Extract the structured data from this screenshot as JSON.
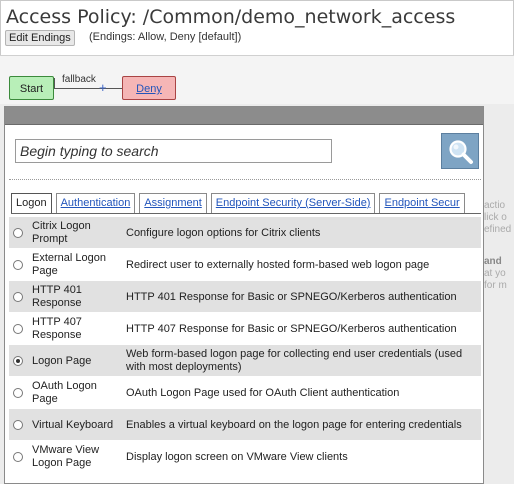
{
  "header": {
    "title": "Access Policy: /Common/demo_network_access",
    "edit_endings_label": "Edit Endings",
    "endings_text": "(Endings: Allow, Deny [default])"
  },
  "flow": {
    "start_label": "Start",
    "branch_label": "fallback",
    "plus_symbol": "+",
    "deny_label": "Deny",
    "start_color": "#b8efb8",
    "deny_color": "#f5b6b6"
  },
  "search": {
    "placeholder": "Begin typing to search",
    "button_icon": "search-icon",
    "button_color": "#7ea4c4"
  },
  "tabs": [
    {
      "label": "Logon",
      "active": true
    },
    {
      "label": "Authentication",
      "active": false
    },
    {
      "label": "Assignment",
      "active": false
    },
    {
      "label": "Endpoint Security (Server-Side)",
      "active": false
    },
    {
      "label": "Endpoint Secur",
      "active": false
    }
  ],
  "items": [
    {
      "name": "Citrix Logon Prompt",
      "description": "Configure logon options for Citrix clients",
      "selected": false
    },
    {
      "name": "External Logon Page",
      "description": "Redirect user to externally hosted form-based web logon page",
      "selected": false
    },
    {
      "name": "HTTP 401 Response",
      "description": "HTTP 401 Response for Basic or SPNEGO/Kerberos authentication",
      "selected": false
    },
    {
      "name": "HTTP 407 Response",
      "description": "HTTP 407 Response for Basic or SPNEGO/Kerberos authentication",
      "selected": false
    },
    {
      "name": "Logon Page",
      "description": "Web form-based logon page for collecting end user credentials (used with most deployments)",
      "selected": true
    },
    {
      "name": "OAuth Logon Page",
      "description": "OAuth Logon Page used for OAuth Client authentication",
      "selected": false
    },
    {
      "name": "Virtual Keyboard",
      "description": "Enables a virtual keyboard on the logon page for entering credentials",
      "selected": false
    },
    {
      "name": "VMware View Logon Page",
      "description": "Display logon screen on VMware View clients",
      "selected": false
    }
  ],
  "background_hint": {
    "lines_top": [
      "actio",
      "lick o",
      "efined"
    ],
    "bold_word": "and",
    "lines_bottom": [
      "at yo",
      "for m"
    ]
  }
}
